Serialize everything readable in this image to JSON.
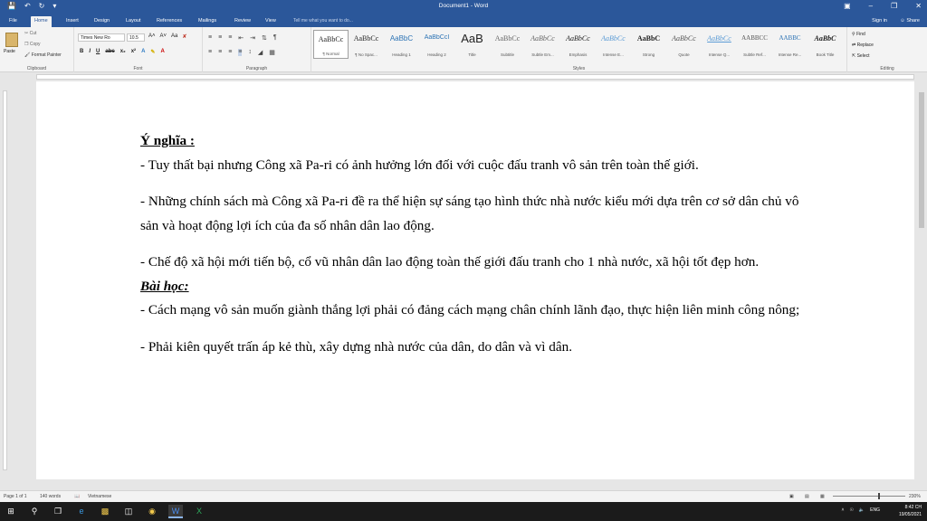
{
  "window": {
    "title": "Document1 - Word"
  },
  "tabs": [
    "File",
    "Home",
    "Insert",
    "Design",
    "Layout",
    "References",
    "Mailings",
    "Review",
    "View"
  ],
  "active_tab": "Home",
  "tell_me": "Tell me what you want to do...",
  "account": {
    "sign_in": "Sign in",
    "share": "Share"
  },
  "ribbon": {
    "clipboard": {
      "label": "Clipboard",
      "paste": "Paste",
      "cut": "Cut",
      "copy": "Copy",
      "format_painter": "Format Painter"
    },
    "font": {
      "label": "Font",
      "name": "Times New Ro",
      "size": "10.5"
    },
    "paragraph": {
      "label": "Paragraph"
    },
    "styles": {
      "label": "Styles",
      "items": [
        {
          "sample": "AaBbCc",
          "name": "¶ Normal"
        },
        {
          "sample": "AaBbCc",
          "name": "¶ No Spac..."
        },
        {
          "sample": "AaBbC",
          "name": "Heading 1"
        },
        {
          "sample": "AaBbCcI",
          "name": "Heading 2"
        },
        {
          "sample": "AaB",
          "name": "Title"
        },
        {
          "sample": "AaBbCc",
          "name": "Subtitle"
        },
        {
          "sample": "AaBbCc",
          "name": "Subtle Em..."
        },
        {
          "sample": "AaBbCc",
          "name": "Emphasis"
        },
        {
          "sample": "AaBbCc",
          "name": "Intense E..."
        },
        {
          "sample": "AaBbC",
          "name": "Strong"
        },
        {
          "sample": "AaBbCc",
          "name": "Quote"
        },
        {
          "sample": "AaBbCc",
          "name": "Intense Q..."
        },
        {
          "sample": "AABBCC",
          "name": "Subtle Ref..."
        },
        {
          "sample": "AABBC",
          "name": "Intense Re..."
        },
        {
          "sample": "AaBbC",
          "name": "Book Title"
        }
      ]
    },
    "editing": {
      "label": "Editing",
      "find": "Find",
      "replace": "Replace",
      "select": "Select"
    }
  },
  "document": {
    "heading1": "Ý nghĩa :",
    "p1": "- Tuy thất bại nhưng Công xã Pa-ri có ảnh hưởng lớn đối với cuộc đấu tranh vô sản trên toàn thế giới.",
    "p2": "- Những chính sách mà Công xã Pa-ri đề ra thể hiện sự sáng tạo hình thức nhà nước kiểu mới dựa trên cơ sở dân chủ vô sản và hoạt động lợi ích của đa số nhân dân lao động.",
    "p3": "- Chế độ xã hội mới tiến bộ, cổ vũ nhân dân lao động toàn thế giới đấu tranh cho 1 nhà nước, xã hội tốt đẹp hơn.",
    "heading2": "Bài học:",
    "p4": "- Cách mạng vô sản muốn giành thắng lợi phải có đảng cách mạng chân chính lãnh đạo, thực hiện liên minh công nông;",
    "p5": "- Phải kiên quyết trấn áp kẻ thù, xây dựng nhà nước của dân, do dân và vì dân."
  },
  "status": {
    "page": "Page 1 of 1",
    "words": "140 words",
    "language": "Vietnamese",
    "zoom": "230%"
  },
  "taskbar": {
    "time": "8:42 CH",
    "date": "19/05/2021",
    "lang": "ENG"
  }
}
